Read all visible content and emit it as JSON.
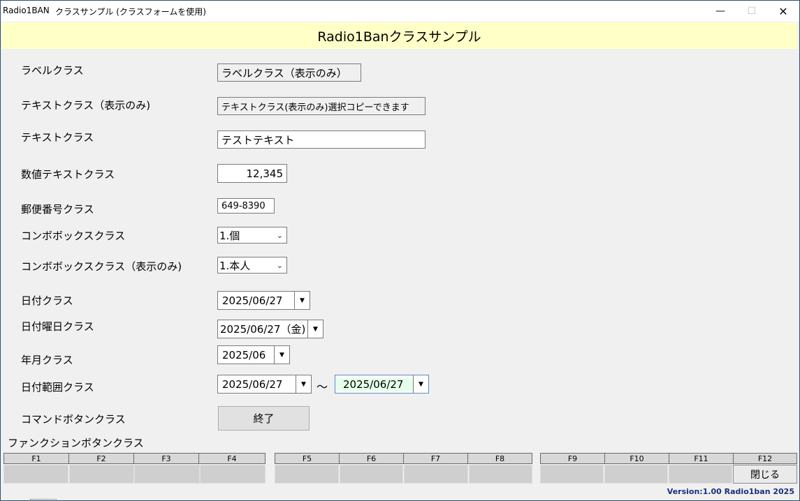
{
  "window": {
    "app_name": "Radio1BAN",
    "title": "クラスサンプル (クラスフォームを使用)"
  },
  "controls": {
    "minimize": "—",
    "maximize": "☐",
    "close": "✕"
  },
  "header": {
    "title": "Radio1Banクラスサンプル"
  },
  "labels": {
    "label_class": "ラベルクラス",
    "text_readonly": "テキストクラス（表示のみ)",
    "text_class": "テキストクラス",
    "numeric_text": "数値テキストクラス",
    "postal_code": "郵便番号クラス",
    "combo_class": "コンボボックスクラス",
    "combo_readonly": "コンボボックスクラス（表示のみ)",
    "date_class": "日付クラス",
    "date_weekday": "日付曜日クラス",
    "year_month": "年月クラス",
    "date_range": "日付範囲クラス",
    "command_button": "コマンドボタンクラス",
    "function_buttons": "ファンクションボタンクラス"
  },
  "values": {
    "label_box": "ラベルクラス（表示のみ）",
    "text_readonly_box": "テキストクラス(表示のみ)選択コピーできます",
    "text_box": "テストテキスト",
    "numeric_box": "12,345",
    "postal_box": "649-8390",
    "combo_value": "1.個",
    "combo_readonly_value": "1.本人",
    "date_value": "2025/06/27",
    "date_weekday_value": "2025/06/27（金)",
    "year_month_value": "2025/06",
    "range_from": "2025/06/27",
    "range_tilde": "～",
    "range_to": "2025/06/27",
    "command_button_label": "終了"
  },
  "function_keys": [
    {
      "key": "F1",
      "label": ""
    },
    {
      "key": "F2",
      "label": ""
    },
    {
      "key": "F3",
      "label": ""
    },
    {
      "key": "F4",
      "label": ""
    },
    {
      "key": "F5",
      "label": ""
    },
    {
      "key": "F6",
      "label": ""
    },
    {
      "key": "F7",
      "label": ""
    },
    {
      "key": "F8",
      "label": ""
    },
    {
      "key": "F9",
      "label": ""
    },
    {
      "key": "F10",
      "label": ""
    },
    {
      "key": "F11",
      "label": ""
    },
    {
      "key": "F12",
      "label": "閉じる"
    }
  ],
  "footer": {
    "version": "Version:1.00 Radio1ban  2025"
  },
  "colors": {
    "header_bg": "#ffffc8",
    "focus_bg": "#e6ffea",
    "version_text": "#1c2f7d"
  }
}
